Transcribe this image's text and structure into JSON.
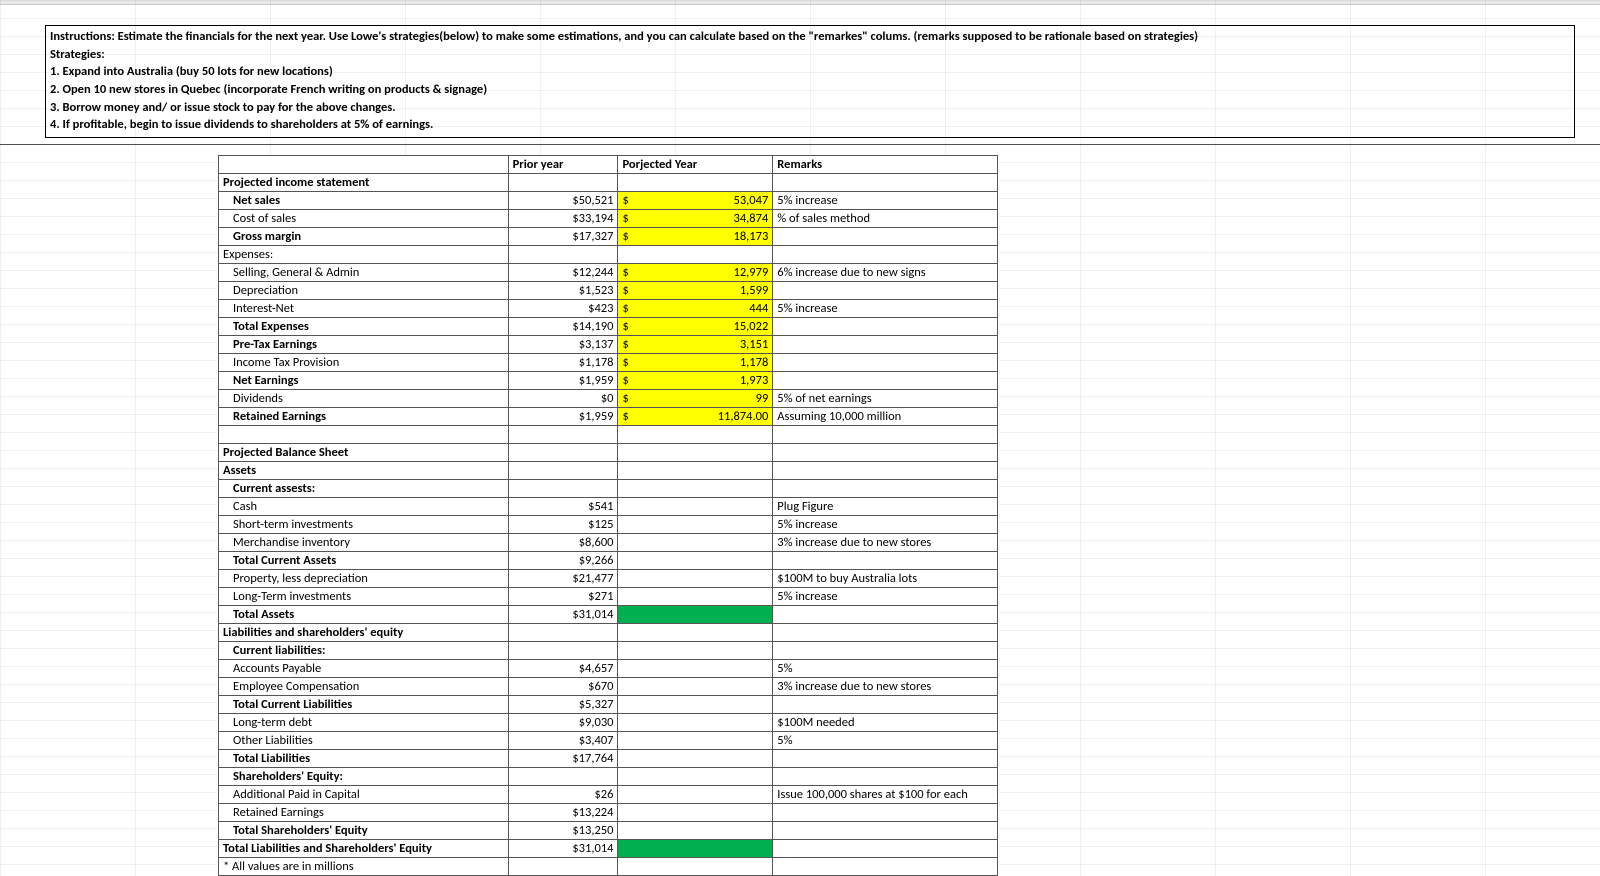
{
  "instructions": {
    "title": "Instructions: Estimate the financials for the next year. Use Lowe's strategies(below) to make some estimations, and you can calculate based on the \"remarkes\" colums. (remarks supposed to be rationale based on strategies)",
    "strategies_label": "Strategies:",
    "items": [
      "1. Expand into Australia (buy 50 lots for new locations)",
      "2. Open 10 new stores in Quebec (incorporate French writing on products & signage)",
      "3. Borrow money and/ or issue stock to pay for the above changes.",
      "4. If profitable, begin to issue dividends to shareholders at 5% of earnings."
    ]
  },
  "headers": {
    "prior": "Prior year",
    "projected": "Porjected Year",
    "remarks": "Remarks"
  },
  "dollar": "$",
  "income": {
    "title": "Projected income statement",
    "rows": [
      {
        "label": "Net sales",
        "prior": "$50,521",
        "proj": "53,047",
        "rem": "5% increase",
        "bold": true,
        "indent": 1
      },
      {
        "label": "Cost of sales",
        "prior": "$33,194",
        "proj": "34,874",
        "rem": "% of sales method",
        "indent": 1
      },
      {
        "label": "Gross margin",
        "prior": "$17,327",
        "proj": "18,173",
        "rem": "",
        "bold": true,
        "indent": 1
      },
      {
        "label": "Expenses:",
        "prior": "",
        "proj": "",
        "rem": "",
        "noProj": true
      },
      {
        "label": "Selling, General & Admin",
        "prior": "$12,244",
        "proj": "12,979",
        "rem": "6% increase due to new signs",
        "indent": 1
      },
      {
        "label": "Depreciation",
        "prior": "$1,523",
        "proj": "1,599",
        "rem": "",
        "indent": 1
      },
      {
        "label": "Interest-Net",
        "prior": "$423",
        "proj": "444",
        "rem": "5% increase",
        "indent": 1
      },
      {
        "label": "Total Expenses",
        "prior": "$14,190",
        "proj": "15,022",
        "rem": "",
        "bold": true,
        "indent": 1
      },
      {
        "label": "Pre-Tax Earnings",
        "prior": "$3,137",
        "proj": "3,151",
        "rem": "",
        "bold": true,
        "indent": 1
      },
      {
        "label": "Income Tax Provision",
        "prior": "$1,178",
        "proj": "1,178",
        "rem": "",
        "indent": 1
      },
      {
        "label": "Net Earnings",
        "prior": "$1,959",
        "proj": "1,973",
        "rem": "",
        "bold": true,
        "indent": 1
      },
      {
        "label": "Dividends",
        "prior": "$0",
        "proj": "99",
        "rem": "5% of net earnings",
        "indent": 1
      },
      {
        "label": "Retained Earnings",
        "prior": "$1,959",
        "proj": "11,874.00",
        "rem": "Assuming 10,000 million",
        "bold": true,
        "indent": 1
      }
    ]
  },
  "balance": {
    "title": "Projected Balance Sheet",
    "assets_title": "Assets",
    "rows_assets": [
      {
        "label": "Current assests:",
        "prior": "",
        "rem": "",
        "bold": true,
        "indent": 1
      },
      {
        "label": "Cash",
        "prior": "$541",
        "rem": "Plug Figure",
        "indent": 1
      },
      {
        "label": "Short-term investments",
        "prior": "$125",
        "rem": "5% increase",
        "indent": 1
      },
      {
        "label": "Merchandise inventory",
        "prior": "$8,600",
        "rem": "3% increase due to new stores",
        "indent": 1
      },
      {
        "label": "Total Current Assets",
        "prior": "$9,266",
        "rem": "",
        "bold": true,
        "indent": 1
      },
      {
        "label": "Property, less depreciation",
        "prior": "$21,477",
        "rem": "$100M to buy Australia lots",
        "indent": 1
      },
      {
        "label": "Long-Term investments",
        "prior": "$271",
        "rem": "5% increase",
        "indent": 1
      },
      {
        "label": "Total Assets",
        "prior": "$31,014",
        "rem": "",
        "bold": true,
        "green": true,
        "indent": 1
      }
    ],
    "liab_title": "Liabilities and shareholders' equity",
    "rows_liab": [
      {
        "label": "Current liabilities:",
        "prior": "",
        "rem": "",
        "bold": true,
        "indent": 1
      },
      {
        "label": "Accounts Payable",
        "prior": "$4,657",
        "rem": "5%",
        "indent": 1
      },
      {
        "label": "Employee Compensation",
        "prior": "$670",
        "rem": "3% increase due to new stores",
        "indent": 1
      },
      {
        "label": "Total Current Liabilities",
        "prior": "$5,327",
        "rem": "",
        "bold": true,
        "indent": 1
      },
      {
        "label": "Long-term debt",
        "prior": "$9,030",
        "rem": "$100M needed",
        "indent": 1
      },
      {
        "label": "Other Liabilities",
        "prior": "$3,407",
        "rem": "5%",
        "indent": 1
      },
      {
        "label": "Total Liabilities",
        "prior": "$17,764",
        "rem": "",
        "bold": true,
        "indent": 1
      },
      {
        "label": "Shareholders' Equity:",
        "prior": "",
        "rem": "",
        "bold": true,
        "indent": 1
      },
      {
        "label": "Additional Paid in Capital",
        "prior": "$26",
        "rem": "Issue 100,000 shares at $100 for each",
        "indent": 1
      },
      {
        "label": "Retained Earnings",
        "prior": "$13,224",
        "rem": "",
        "indent": 1
      },
      {
        "label": "Total Shareholders' Equity",
        "prior": "$13,250",
        "rem": "",
        "bold": true,
        "indent": 1
      },
      {
        "label": "Total Liabilities and Shareholders' Equity",
        "prior": "$31,014",
        "rem": "",
        "bold": true,
        "green": true
      }
    ],
    "footnote": "* All values are in millions"
  }
}
